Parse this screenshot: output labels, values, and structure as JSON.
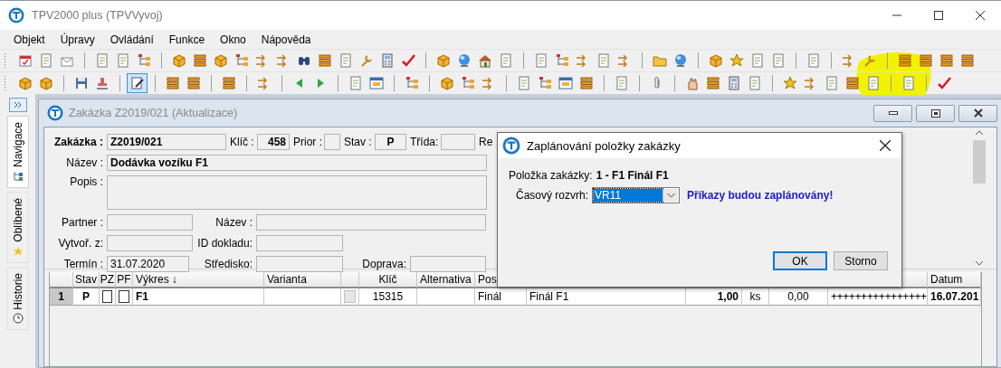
{
  "window": {
    "title": "TPV2000 plus (TPVVyvoj)"
  },
  "menu": [
    "Objekt",
    "Úpravy",
    "Ovládání",
    "Funkce",
    "Okno",
    "Nápověda"
  ],
  "toolbar_toggle": {
    "pressed": true
  },
  "sidebar": {
    "tabs": [
      {
        "label": "Navigace",
        "selected": true
      },
      {
        "label": "Oblíbené",
        "selected": false
      },
      {
        "label": "Historie",
        "selected": false
      }
    ]
  },
  "document_window": {
    "title": "Zakázka Z2019/021 (Aktualizace)",
    "form": [
      [
        {
          "label": "Zakázka :",
          "value": "Z2019/021"
        },
        {
          "label": "Klíč :",
          "value": "458"
        },
        {
          "label": "Prior :"
        },
        {
          "label": "Stav :",
          "value": "P"
        },
        {
          "label": "Třída:"
        },
        {
          "label": "Re"
        }
      ],
      [
        {
          "label": "Název :",
          "value": "Dodávka vozíku F1"
        }
      ],
      [
        {
          "label": "Popis :"
        }
      ],
      [
        {
          "label": "Partner :"
        },
        {
          "label": "Název :"
        }
      ],
      [
        {
          "label": "Vytvoř. z:"
        },
        {
          "label": "ID dokladu:"
        }
      ],
      [
        {
          "label": "Termín :",
          "value": "31.07.2020"
        },
        {
          "label": "Středisko:"
        },
        {
          "label": "Doprava:"
        }
      ]
    ],
    "table": {
      "columns": [
        {},
        {
          "header": "Stav"
        },
        {
          "header": "PZ"
        },
        {
          "header": "PF"
        },
        {
          "header": "Výkres",
          "sort_mark": "↓"
        },
        {
          "header": "Varianta"
        },
        {},
        {
          "header": "Klíč"
        },
        {
          "header": "Alternativa"
        },
        {
          "header": "Pos"
        },
        {},
        {},
        {},
        {},
        {},
        {
          "header": "Datum"
        }
      ],
      "rows": [
        [
          {
            "kind": "text",
            "text": "1"
          },
          {
            "kind": "text",
            "text": "P"
          },
          {
            "kind": "checkbox",
            "checked": false,
            "disabled": false
          },
          {
            "kind": "checkbox",
            "checked": false,
            "disabled": false
          },
          {
            "kind": "text",
            "text": "F1"
          },
          {
            "kind": "empty"
          },
          {
            "kind": "checkbox",
            "checked": false,
            "disabled": true
          },
          {
            "kind": "text",
            "text": "15315"
          },
          {
            "kind": "empty"
          },
          {
            "kind": "text",
            "text": "Finál"
          },
          {
            "kind": "text",
            "text": "Finál F1"
          },
          {
            "kind": "text",
            "text": "1,00"
          },
          {
            "kind": "text",
            "text": "ks"
          },
          {
            "kind": "text",
            "text": "0,00"
          },
          {
            "kind": "text",
            "text": "++++++++++++++++"
          },
          {
            "kind": "text",
            "text": "16.07.201"
          }
        ]
      ]
    }
  },
  "dialog": {
    "title": "Zaplánování položky zakázky",
    "item_label": "Položka zakázky:",
    "item_value": "1 - F1 Finál F1",
    "schedule_label": "Časový rozvrh:",
    "schedule_value": "VR11",
    "message": "Příkazy budou zaplánovány!",
    "buttons": [
      {
        "label": "OK",
        "default": true
      },
      {
        "label": "Storno",
        "default": false
      }
    ]
  }
}
